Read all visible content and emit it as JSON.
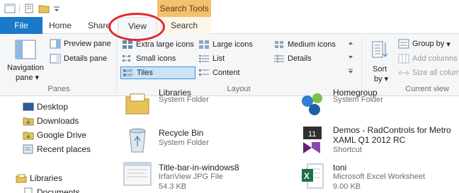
{
  "contextual_tab": "Search Tools",
  "tabs": {
    "file": "File",
    "home": "Home",
    "share": "Share",
    "view": "View",
    "search": "Search"
  },
  "ribbon": {
    "panes": {
      "navigation_pane": "Navigation",
      "navigation_pane_2": "pane",
      "preview_pane": "Preview pane",
      "details_pane": "Details pane",
      "label": "Panes"
    },
    "layout": {
      "extra_large_icons": "Extra large icons",
      "large_icons": "Large icons",
      "medium_icons": "Medium icons",
      "small_icons": "Small icons",
      "list": "List",
      "details": "Details",
      "tiles": "Tiles",
      "content": "Content",
      "label": "Layout"
    },
    "current_view": {
      "sort_by": "Sort",
      "sort_by_2": "by",
      "group_by": "Group by",
      "add_columns": "Add columns",
      "size_all_columns": "Size all colum",
      "label": "Current view"
    }
  },
  "nav": [
    {
      "label": "Desktop",
      "icon": "desktop-icon"
    },
    {
      "label": "Downloads",
      "icon": "downloads-icon"
    },
    {
      "label": "Google Drive",
      "icon": "google-drive-icon"
    },
    {
      "label": "Recent places",
      "icon": "recent-places-icon"
    },
    {
      "label": "Libraries",
      "icon": "libraries-icon"
    },
    {
      "label": "Documents",
      "icon": "documents-icon"
    }
  ],
  "files": [
    {
      "name": "Libraries",
      "type": "System Folder",
      "icon": "libraries-folder-icon"
    },
    {
      "name": "Homegroup",
      "type": "System Folder",
      "icon": "homegroup-icon"
    },
    {
      "name": "Recycle Bin",
      "type": "System Folder",
      "icon": "recycle-bin-icon"
    },
    {
      "name": "Demos - RadControls for Metro",
      "type": "XAML Q1 2012 RC",
      "extra": "Shortcut",
      "icon": "visual-studio-shortcut-icon"
    },
    {
      "name": "Title-bar-in-windows8",
      "type": "IrfanView JPG File",
      "extra": "54.3 KB",
      "icon": "jpg-file-icon"
    },
    {
      "name": "toni",
      "type": "Microsoft Excel Worksheet",
      "extra": "9.00 KB",
      "icon": "excel-file-icon"
    }
  ],
  "colors": {
    "file_tab": "#1979ca",
    "contextual_tab": "#f3c16e",
    "annotation": "#e0262c",
    "selection": "#cce4f7"
  }
}
